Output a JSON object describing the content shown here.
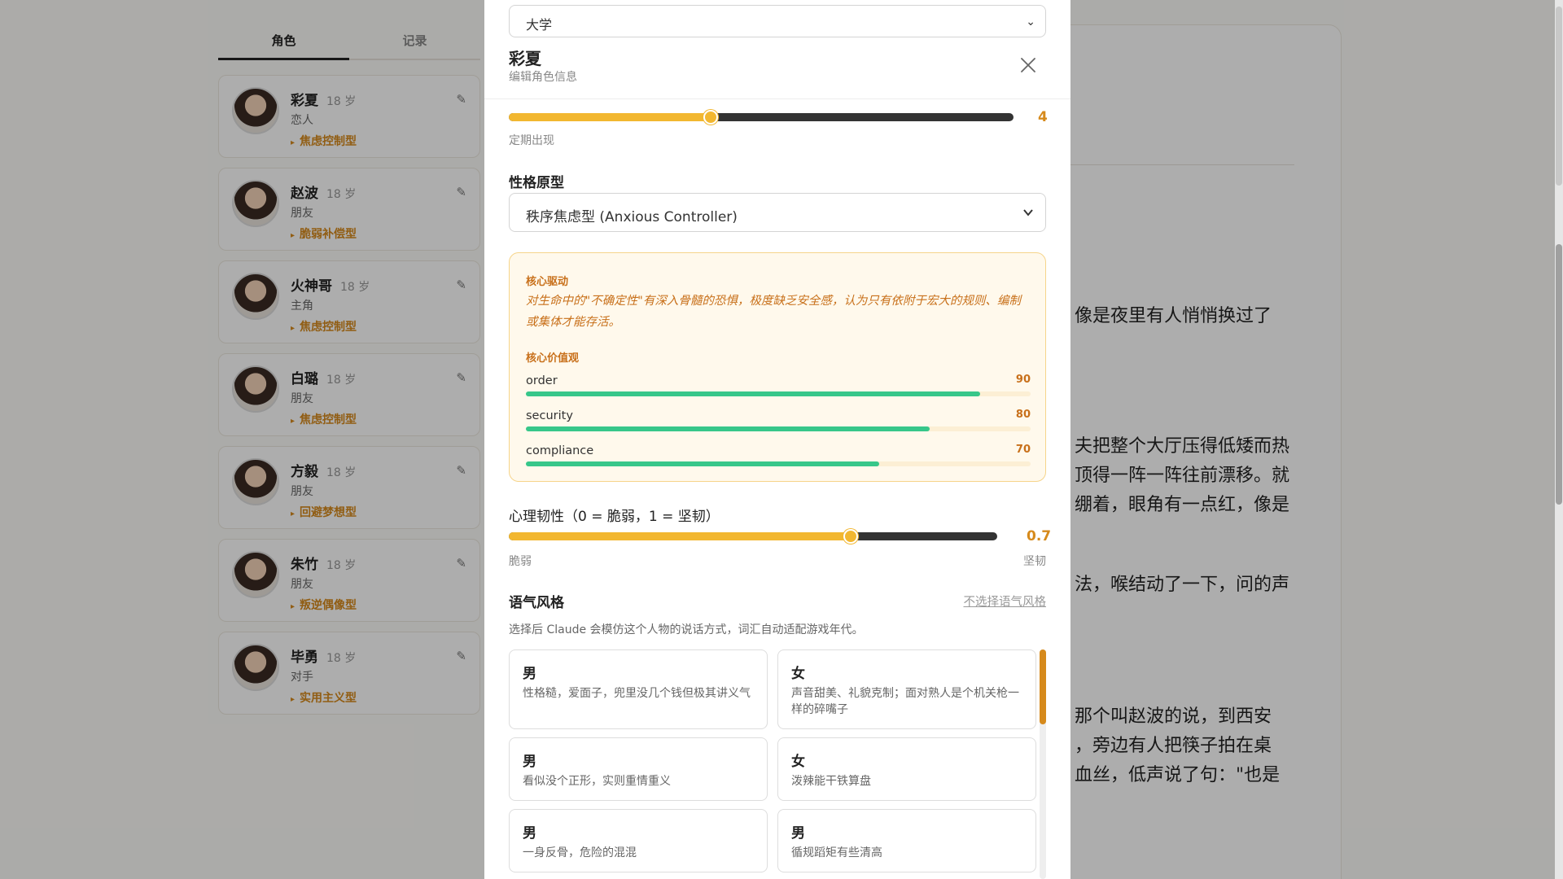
{
  "tabs": [
    "角色",
    "记录"
  ],
  "characters": [
    {
      "name": "彩夏",
      "age": "18 岁",
      "relation": "恋人",
      "type": "焦虑控制型"
    },
    {
      "name": "赵波",
      "age": "18 岁",
      "relation": "朋友",
      "type": "脆弱补偿型"
    },
    {
      "name": "火神哥",
      "age": "18 岁",
      "relation": "主角",
      "type": "焦虑控制型"
    },
    {
      "name": "白璐",
      "age": "18 岁",
      "relation": "朋友",
      "type": "焦虑控制型"
    },
    {
      "name": "方毅",
      "age": "18 岁",
      "relation": "朋友",
      "type": "回避梦想型"
    },
    {
      "name": "朱竹",
      "age": "18 岁",
      "relation": "朋友",
      "type": "叛逆偶像型"
    },
    {
      "name": "毕勇",
      "age": "18 岁",
      "relation": "对手",
      "type": "实用主义型"
    }
  ],
  "story": {
    "lines": [
      "像是夜里有人悄悄换过了",
      "夫把整个大厅压得低矮而热",
      "顶得一阵一阵往前漂移。就",
      "绷着，眼角有一点红，像是",
      "法，喉结动了一下，问的声",
      "那个叫赵波的说，到西安",
      "，旁边有人把筷子拍在桌",
      "血丝，低声说了句：\"也是"
    ]
  },
  "modal": {
    "top_select_value": "大学",
    "title": "彩夏",
    "subtitle": "编辑角色信息",
    "frequency": {
      "value": "4",
      "fraction": 0.4,
      "caption": "定期出现"
    },
    "archetype": {
      "label": "性格原型",
      "value": "秩序焦虑型 (Anxious Controller)"
    },
    "core_drive": {
      "heading": "核心驱动",
      "text": "对生命中的\"不确定性\"有深入骨髓的恐惧，极度缺乏安全感，认为只有依附于宏大的规则、编制或集体才能存活。"
    },
    "core_values": {
      "heading": "核心价值观",
      "items": [
        {
          "name": "order",
          "value": 90
        },
        {
          "name": "security",
          "value": 80
        },
        {
          "name": "compliance",
          "value": 70
        }
      ]
    },
    "resilience": {
      "label": "心理韧性（0 = 脆弱，1 = 坚韧）",
      "value": "0.7",
      "fraction": 0.7,
      "min_label": "脆弱",
      "max_label": "坚韧"
    },
    "tone": {
      "label": "语气风格",
      "clear_link": "不选择语气风格",
      "hint": "选择后 Claude 会模仿这个人物的说话方式，词汇自动适配游戏年代。",
      "options": [
        {
          "gender": "男",
          "desc": "性格糙，爱面子，兜里没几个钱但极其讲义气"
        },
        {
          "gender": "女",
          "desc": "声音甜美、礼貌克制；面对熟人是个机关枪一样的碎嘴子"
        },
        {
          "gender": "男",
          "desc": "看似没个正形，实则重情重义"
        },
        {
          "gender": "女",
          "desc": "泼辣能干铁算盘"
        },
        {
          "gender": "男",
          "desc": "一身反骨，危险的混混"
        },
        {
          "gender": "男",
          "desc": "循规蹈矩有些清高"
        }
      ]
    }
  },
  "colors": {
    "accent": "#d68a1c",
    "slider_fill": "#f2b730",
    "value_bar": "#37c78a"
  }
}
